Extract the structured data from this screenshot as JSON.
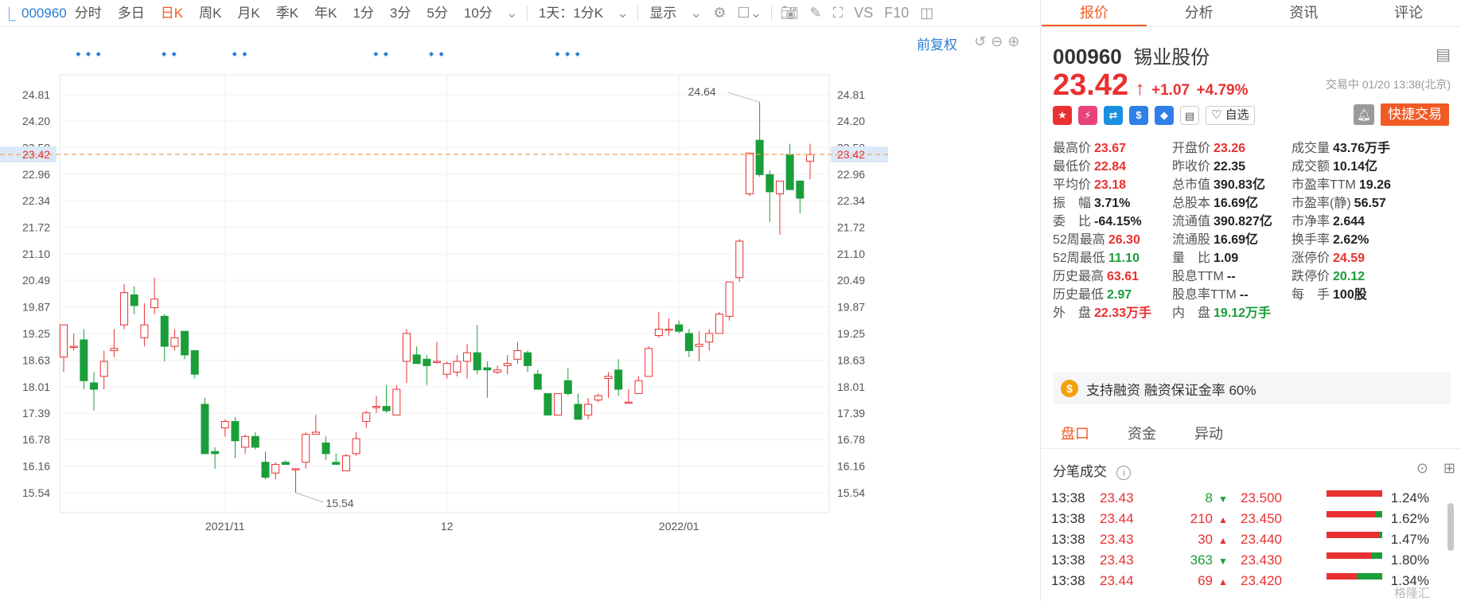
{
  "toolbar": {
    "stock_code": "000960",
    "periods": [
      "分时",
      "多日",
      "日K",
      "周K",
      "月K",
      "季K",
      "年K",
      "1分",
      "3分",
      "5分",
      "10分"
    ],
    "active_period": "日K",
    "interval": "1天：1分K",
    "display": "显示",
    "vs": "VS",
    "f10": "F10"
  },
  "chart": {
    "fuquan_label": "前复权",
    "current_price_label": "23.42",
    "high_annotation": "24.64",
    "low_annotation": "15.54"
  },
  "chart_data": {
    "type": "candlestick",
    "y_ticks": [
      "24.81",
      "24.20",
      "23.58",
      "22.96",
      "22.34",
      "21.72",
      "21.10",
      "20.49",
      "19.87",
      "19.25",
      "18.63",
      "18.01",
      "17.39",
      "16.78",
      "16.16",
      "15.54"
    ],
    "x_ticks": [
      "2021/11",
      "12",
      "2022/01"
    ],
    "ylim": [
      15.54,
      24.81
    ],
    "current_price": 23.42,
    "candles": [
      {
        "o": 18.7,
        "h": 19.45,
        "l": 18.35,
        "c": 19.45
      },
      {
        "o": 18.95,
        "h": 19.25,
        "l": 18.85,
        "c": 18.95
      },
      {
        "o": 19.1,
        "h": 19.35,
        "l": 17.95,
        "c": 18.15
      },
      {
        "o": 18.1,
        "h": 18.35,
        "l": 17.45,
        "c": 17.95
      },
      {
        "o": 18.25,
        "h": 18.85,
        "l": 17.95,
        "c": 18.6
      },
      {
        "o": 18.85,
        "h": 19.35,
        "l": 18.7,
        "c": 18.9
      },
      {
        "o": 19.45,
        "h": 20.4,
        "l": 19.35,
        "c": 20.2
      },
      {
        "o": 20.15,
        "h": 20.35,
        "l": 19.7,
        "c": 19.9
      },
      {
        "o": 19.15,
        "h": 19.95,
        "l": 18.95,
        "c": 19.45
      },
      {
        "o": 19.85,
        "h": 20.55,
        "l": 19.7,
        "c": 20.05
      },
      {
        "o": 19.65,
        "h": 19.7,
        "l": 18.6,
        "c": 18.95
      },
      {
        "o": 18.95,
        "h": 19.35,
        "l": 18.85,
        "c": 19.15
      },
      {
        "o": 19.3,
        "h": 19.3,
        "l": 18.65,
        "c": 18.75
      },
      {
        "o": 18.85,
        "h": 18.85,
        "l": 18.2,
        "c": 18.3
      },
      {
        "o": 17.6,
        "h": 17.75,
        "l": 16.45,
        "c": 16.45
      },
      {
        "o": 16.5,
        "h": 16.6,
        "l": 16.1,
        "c": 16.45
      },
      {
        "o": 17.05,
        "h": 17.25,
        "l": 16.85,
        "c": 17.2
      },
      {
        "o": 17.2,
        "h": 17.3,
        "l": 16.35,
        "c": 16.75
      },
      {
        "o": 16.6,
        "h": 16.9,
        "l": 16.45,
        "c": 16.85
      },
      {
        "o": 16.85,
        "h": 16.95,
        "l": 16.55,
        "c": 16.6
      },
      {
        "o": 16.25,
        "h": 16.5,
        "l": 15.85,
        "c": 15.9
      },
      {
        "o": 16.0,
        "h": 16.25,
        "l": 15.85,
        "c": 16.2
      },
      {
        "o": 16.25,
        "h": 16.3,
        "l": 16.2,
        "c": 16.2
      },
      {
        "o": 16.1,
        "h": 16.1,
        "l": 15.54,
        "c": 16.1
      },
      {
        "o": 16.25,
        "h": 16.95,
        "l": 16.1,
        "c": 16.9
      },
      {
        "o": 16.9,
        "h": 17.35,
        "l": 16.9,
        "c": 16.95
      },
      {
        "o": 16.7,
        "h": 16.85,
        "l": 16.3,
        "c": 16.45
      },
      {
        "o": 16.25,
        "h": 16.45,
        "l": 16.2,
        "c": 16.2
      },
      {
        "o": 16.05,
        "h": 16.45,
        "l": 16.05,
        "c": 16.4
      },
      {
        "o": 16.45,
        "h": 16.95,
        "l": 16.4,
        "c": 16.8
      },
      {
        "o": 17.2,
        "h": 17.45,
        "l": 17.05,
        "c": 17.4
      },
      {
        "o": 17.55,
        "h": 17.8,
        "l": 17.4,
        "c": 17.55
      },
      {
        "o": 17.55,
        "h": 18.05,
        "l": 17.4,
        "c": 17.45
      },
      {
        "o": 17.35,
        "h": 18.05,
        "l": 17.35,
        "c": 17.95
      },
      {
        "o": 18.6,
        "h": 19.35,
        "l": 18.1,
        "c": 19.25
      },
      {
        "o": 18.75,
        "h": 18.95,
        "l": 18.55,
        "c": 18.55
      },
      {
        "o": 18.65,
        "h": 18.75,
        "l": 18.05,
        "c": 18.5
      },
      {
        "o": 18.6,
        "h": 19.05,
        "l": 18.55,
        "c": 18.6
      },
      {
        "o": 18.3,
        "h": 18.6,
        "l": 18.2,
        "c": 18.55
      },
      {
        "o": 18.35,
        "h": 18.75,
        "l": 18.25,
        "c": 18.6
      },
      {
        "o": 18.6,
        "h": 19.0,
        "l": 18.2,
        "c": 18.8
      },
      {
        "o": 18.8,
        "h": 19.45,
        "l": 18.3,
        "c": 18.4
      },
      {
        "o": 18.45,
        "h": 18.6,
        "l": 17.75,
        "c": 18.4
      },
      {
        "o": 18.35,
        "h": 18.5,
        "l": 18.3,
        "c": 18.4
      },
      {
        "o": 18.5,
        "h": 18.75,
        "l": 18.3,
        "c": 18.55
      },
      {
        "o": 18.65,
        "h": 19.05,
        "l": 18.55,
        "c": 18.85
      },
      {
        "o": 18.8,
        "h": 18.85,
        "l": 18.35,
        "c": 18.5
      },
      {
        "o": 18.3,
        "h": 18.4,
        "l": 17.95,
        "c": 17.95
      },
      {
        "o": 17.85,
        "h": 17.85,
        "l": 17.4,
        "c": 17.35
      },
      {
        "o": 17.35,
        "h": 17.85,
        "l": 17.35,
        "c": 17.85
      },
      {
        "o": 18.15,
        "h": 18.45,
        "l": 17.8,
        "c": 17.85
      },
      {
        "o": 17.6,
        "h": 17.85,
        "l": 17.25,
        "c": 17.25
      },
      {
        "o": 17.35,
        "h": 17.75,
        "l": 17.25,
        "c": 17.6
      },
      {
        "o": 17.7,
        "h": 17.85,
        "l": 17.65,
        "c": 17.8
      },
      {
        "o": 18.2,
        "h": 18.35,
        "l": 17.75,
        "c": 18.25
      },
      {
        "o": 18.4,
        "h": 18.65,
        "l": 17.8,
        "c": 17.95
      },
      {
        "o": 17.65,
        "h": 17.95,
        "l": 17.65,
        "c": 17.65
      },
      {
        "o": 17.85,
        "h": 18.25,
        "l": 17.85,
        "c": 18.15
      },
      {
        "o": 18.25,
        "h": 18.95,
        "l": 18.25,
        "c": 18.9
      },
      {
        "o": 19.2,
        "h": 19.75,
        "l": 19.15,
        "c": 19.35
      },
      {
        "o": 19.35,
        "h": 19.6,
        "l": 19.2,
        "c": 19.35
      },
      {
        "o": 19.45,
        "h": 19.55,
        "l": 19.25,
        "c": 19.3
      },
      {
        "o": 19.25,
        "h": 19.35,
        "l": 18.7,
        "c": 18.85
      },
      {
        "o": 18.95,
        "h": 19.3,
        "l": 18.6,
        "c": 19.0
      },
      {
        "o": 19.05,
        "h": 19.35,
        "l": 18.85,
        "c": 19.25
      },
      {
        "o": 19.25,
        "h": 19.75,
        "l": 19.25,
        "c": 19.7
      },
      {
        "o": 19.65,
        "h": 20.45,
        "l": 19.55,
        "c": 20.45
      },
      {
        "o": 20.55,
        "h": 21.45,
        "l": 20.45,
        "c": 21.4
      },
      {
        "o": 22.5,
        "h": 22.75,
        "l": 22.45,
        "c": 23.45
      },
      {
        "o": 23.75,
        "h": 24.64,
        "l": 22.9,
        "c": 22.95
      },
      {
        "o": 22.95,
        "h": 23.05,
        "l": 21.85,
        "c": 22.55
      },
      {
        "o": 22.5,
        "h": 22.75,
        "l": 21.55,
        "c": 22.8
      },
      {
        "o": 23.42,
        "h": 23.67,
        "l": 22.84,
        "c": 22.6
      },
      {
        "o": 22.8,
        "h": 22.8,
        "l": 22.05,
        "c": 22.4
      },
      {
        "o": 23.26,
        "h": 23.67,
        "l": 22.84,
        "c": 23.42
      }
    ]
  },
  "tabs": [
    "报价",
    "分析",
    "资讯",
    "评论"
  ],
  "active_tab": "报价",
  "quote": {
    "code": "000960",
    "name": "锡业股份",
    "price": "23.42",
    "change": "+1.07",
    "change_pct": "+4.79%",
    "trade_time": "交易中 01/20 13:38(北京)",
    "zixuan": "自选",
    "quick_trade": "快捷交易"
  },
  "stats": [
    {
      "label": "最高价",
      "value": "23.67",
      "color": "red"
    },
    {
      "label": "开盘价",
      "value": "23.26",
      "color": "red"
    },
    {
      "label": "成交量",
      "value": "43.76万手",
      "color": "dark"
    },
    {
      "label": "最低价",
      "value": "22.84",
      "color": "red"
    },
    {
      "label": "昨收价",
      "value": "22.35",
      "color": "dark"
    },
    {
      "label": "成交额",
      "value": "10.14亿",
      "color": "dark"
    },
    {
      "label": "平均价",
      "value": "23.18",
      "color": "red"
    },
    {
      "label": "总市值",
      "value": "390.83亿",
      "color": "dark"
    },
    {
      "label": "市盈率TTM",
      "value": "19.26",
      "color": "dark"
    },
    {
      "label": "振　幅",
      "value": "3.71%",
      "color": "dark"
    },
    {
      "label": "总股本",
      "value": "16.69亿",
      "color": "dark"
    },
    {
      "label": "市盈率(静)",
      "value": "56.57",
      "color": "dark"
    },
    {
      "label": "委　比",
      "value": "-64.15%",
      "color": "dark"
    },
    {
      "label": "流通值",
      "value": "390.827亿",
      "color": "dark"
    },
    {
      "label": "市净率",
      "value": "2.644",
      "color": "dark"
    },
    {
      "label": "52周最高",
      "value": "26.30",
      "color": "red"
    },
    {
      "label": "流通股",
      "value": "16.69亿",
      "color": "dark"
    },
    {
      "label": "换手率",
      "value": "2.62%",
      "color": "dark"
    },
    {
      "label": "52周最低",
      "value": "11.10",
      "color": "green"
    },
    {
      "label": "量　比",
      "value": "1.09",
      "color": "dark"
    },
    {
      "label": "涨停价",
      "value": "24.59",
      "color": "red"
    },
    {
      "label": "历史最高",
      "value": "63.61",
      "color": "red"
    },
    {
      "label": "股息TTM",
      "value": "--",
      "color": "dark"
    },
    {
      "label": "跌停价",
      "value": "20.12",
      "color": "green"
    },
    {
      "label": "历史最低",
      "value": "2.97",
      "color": "green"
    },
    {
      "label": "股息率TTM",
      "value": "--",
      "color": "dark"
    },
    {
      "label": "每　手",
      "value": "100股",
      "color": "dark"
    },
    {
      "label": "外　盘",
      "value": "22.33万手",
      "color": "red"
    },
    {
      "label": "内　盘",
      "value": "19.12万手",
      "color": "green"
    }
  ],
  "margin_text": "支持融资 融资保证金率 60%",
  "subtabs": [
    "盘口",
    "资金",
    "异动"
  ],
  "active_subtab": "盘口",
  "tick_title": "分笔成交",
  "ticks": [
    {
      "time": "13:38",
      "price": "23.43",
      "vol": "8",
      "dir": "down",
      "level": "23.500",
      "pct": "1.24%",
      "green_frac": 0.0
    },
    {
      "time": "13:38",
      "price": "23.44",
      "vol": "210",
      "dir": "up",
      "level": "23.450",
      "pct": "1.62%",
      "green_frac": 0.12
    },
    {
      "time": "13:38",
      "price": "23.43",
      "vol": "30",
      "dir": "up",
      "level": "23.440",
      "pct": "1.47%",
      "green_frac": 0.05
    },
    {
      "time": "13:38",
      "price": "23.43",
      "vol": "363",
      "dir": "down",
      "level": "23.430",
      "pct": "1.80%",
      "green_frac": 0.2
    },
    {
      "time": "13:38",
      "price": "23.44",
      "vol": "69",
      "dir": "up",
      "level": "23.420",
      "pct": "1.34%",
      "green_frac": 0.45
    }
  ],
  "watermark": "格隆汇",
  "colors": {
    "up": "#e93030",
    "down": "#1a9e3a",
    "accent": "#f25a24",
    "link": "#2a7dd6"
  }
}
